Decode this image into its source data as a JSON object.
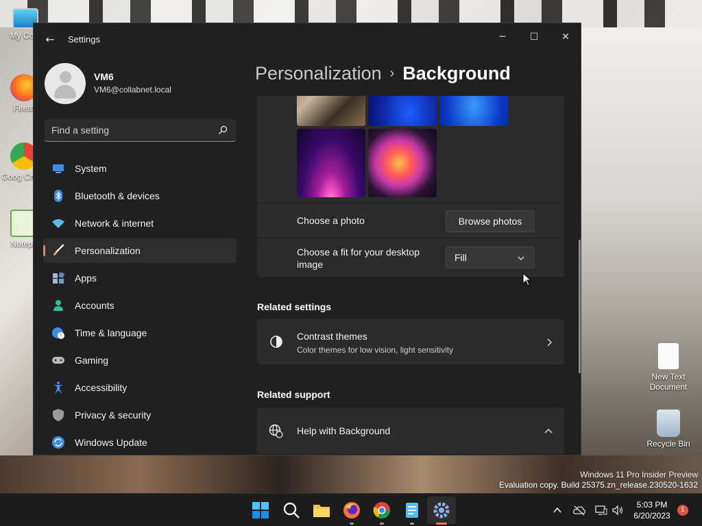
{
  "desktop": {
    "icons": [
      {
        "label": "My Com"
      },
      {
        "label": "Firefo"
      },
      {
        "label": "Goog Chron"
      },
      {
        "label": "Notepa"
      },
      {
        "label": "New Text Document"
      },
      {
        "label": "Recycle Bin"
      }
    ],
    "watermark": {
      "line1": "Windows 11 Pro Insider Preview",
      "line2": "Evaluation copy. Build 25375.zn_release.230520-1632"
    }
  },
  "window": {
    "title": "Settings",
    "controls": {
      "minimize": "─",
      "maximize": "☐",
      "close": "✕"
    },
    "back_glyph": "←"
  },
  "profile": {
    "name": "VM6",
    "email": "VM6@collabnet.local"
  },
  "search": {
    "placeholder": "Find a setting"
  },
  "sidebar": {
    "items": [
      {
        "label": "System",
        "icon": "monitor-icon",
        "color": "#3a8ee6"
      },
      {
        "label": "Bluetooth & devices",
        "icon": "bluetooth-icon",
        "color": "#3a8ee6"
      },
      {
        "label": "Network & internet",
        "icon": "wifi-icon",
        "color": "#5cb8f5"
      },
      {
        "label": "Personalization",
        "icon": "brush-icon",
        "color": "#e8a24a",
        "active": true
      },
      {
        "label": "Apps",
        "icon": "apps-icon",
        "color": "#9fb8d8"
      },
      {
        "label": "Accounts",
        "icon": "person-icon",
        "color": "#2fbf9a"
      },
      {
        "label": "Time & language",
        "icon": "globe-clock-icon",
        "color": "#3a8ee6"
      },
      {
        "label": "Gaming",
        "icon": "gamepad-icon",
        "color": "#b8b8b8"
      },
      {
        "label": "Accessibility",
        "icon": "accessibility-icon",
        "color": "#3a8ee6"
      },
      {
        "label": "Privacy & security",
        "icon": "shield-icon",
        "color": "#9a9a9a"
      },
      {
        "label": "Windows Update",
        "icon": "update-icon",
        "color": "#3a8ee6"
      }
    ]
  },
  "breadcrumb": {
    "parent": "Personalization",
    "separator": "›",
    "current": "Background"
  },
  "background_settings": {
    "choose_photo_label": "Choose a photo",
    "browse_button": "Browse photos",
    "fit_label": "Choose a fit for your desktop image",
    "fit_value": "Fill"
  },
  "related_settings": {
    "title": "Related settings",
    "items": [
      {
        "title": "Contrast themes",
        "subtitle": "Color themes for low vision, light sensitivity"
      }
    ]
  },
  "related_support": {
    "title": "Related support",
    "items": [
      {
        "title": "Help with Background"
      }
    ]
  },
  "taskbar": {
    "clock_time": "5:03 PM",
    "clock_date": "6/20/2023",
    "notification_count": "1"
  },
  "colors": {
    "accent": "#e97a6c",
    "window_bg": "#202020",
    "card_bg": "#2b2b2b"
  }
}
